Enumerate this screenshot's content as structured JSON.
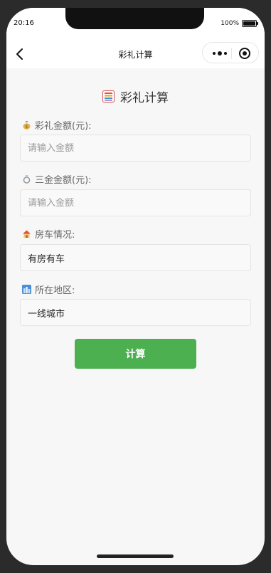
{
  "status": {
    "time": "20:16",
    "battery": "100%"
  },
  "nav": {
    "title": "彩礼计算"
  },
  "page": {
    "title": "彩礼计算"
  },
  "form": {
    "fields": [
      {
        "icon": "money-bag-icon",
        "label": "彩礼金额(元):",
        "placeholder": "请输入金额",
        "value": ""
      },
      {
        "icon": "ring-icon",
        "label": "三金金额(元):",
        "placeholder": "请输入金额",
        "value": ""
      },
      {
        "icon": "house-icon",
        "label": "房车情况:",
        "value": "有房有车"
      },
      {
        "icon": "cityscape-icon",
        "label": "所在地区:",
        "value": "一线城市"
      }
    ],
    "submit_label": "计算"
  },
  "colors": {
    "accent": "#4caf50",
    "background": "#f7f7f7"
  }
}
